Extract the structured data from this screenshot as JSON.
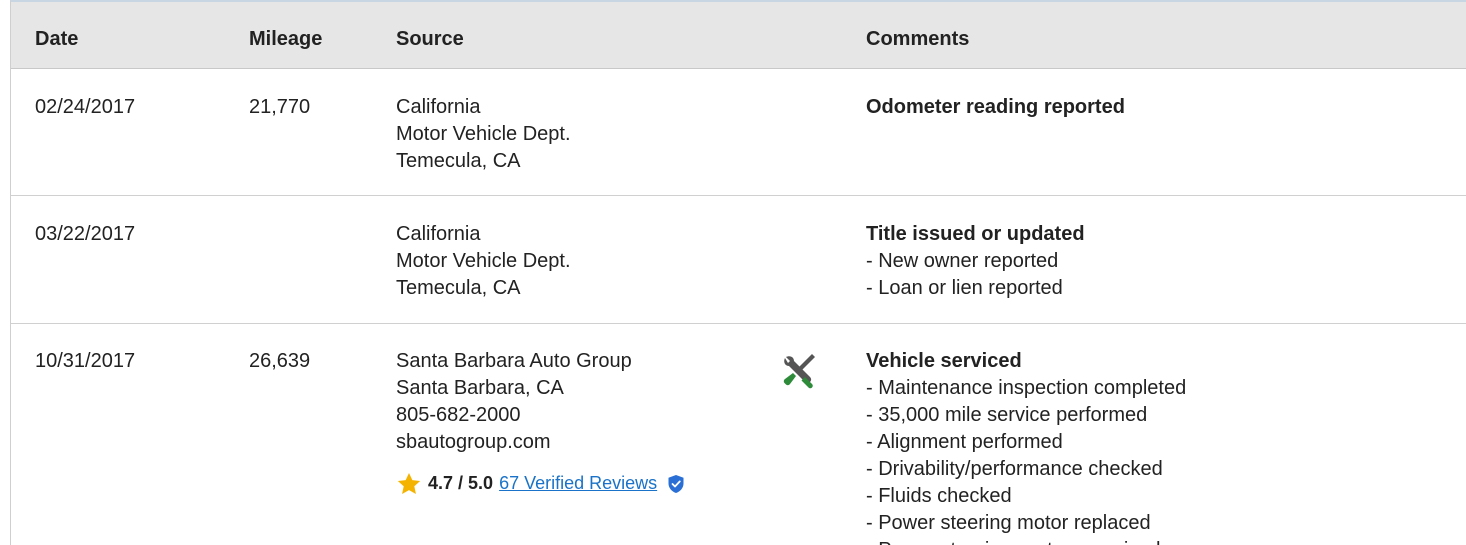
{
  "table": {
    "headers": {
      "date": "Date",
      "mileage": "Mileage",
      "source": "Source",
      "comments": "Comments"
    },
    "rows": [
      {
        "date": "02/24/2017",
        "mileage": "21,770",
        "source": [
          "California",
          "Motor Vehicle Dept.",
          "Temecula, CA"
        ],
        "comment_title": "Odometer reading reported",
        "comment_items": []
      },
      {
        "date": "03/22/2017",
        "mileage": "",
        "source": [
          "California",
          "Motor Vehicle Dept.",
          "Temecula, CA"
        ],
        "comment_title": "Title issued or updated",
        "comment_items": [
          "- New owner reported",
          "- Loan or lien reported"
        ]
      },
      {
        "date": "10/31/2017",
        "mileage": "26,639",
        "source": [
          "Santa Barbara Auto Group",
          "Santa Barbara, CA",
          "805-682-2000",
          "sbautogroup.com"
        ],
        "rating": {
          "score": "4.7 / 5.0",
          "reviews_link": "67 Verified Reviews"
        },
        "icon": "service-wrench-screwdriver-icon",
        "comment_title": "Vehicle serviced",
        "comment_items": [
          "- Maintenance inspection completed",
          "- 35,000 mile service performed",
          "- Alignment performed",
          "- Drivability/performance checked",
          "- Fluids checked",
          "- Power steering motor replaced",
          "- Power steering system serviced"
        ]
      }
    ]
  },
  "colors": {
    "header_bg": "#e6e6e6",
    "link": "#1a73c8",
    "star": "#f5b301",
    "shield": "#2a6fd6",
    "wrench_green": "#2e8b3a",
    "wrench_gray": "#555555"
  }
}
